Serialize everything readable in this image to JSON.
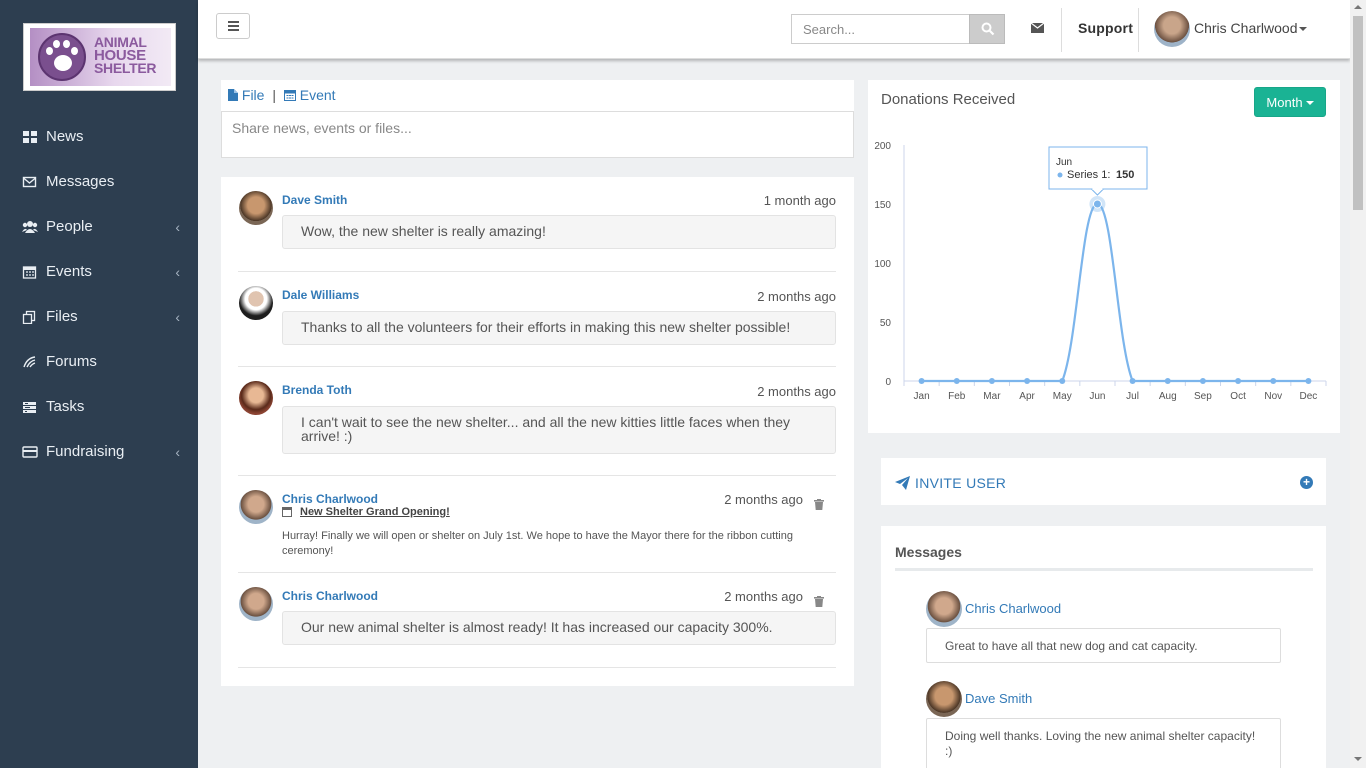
{
  "brand": {
    "logo_line1": "ANIMAL",
    "logo_line2": "HOUSE",
    "logo_line3": "SHELTER",
    "logo_color": "#8b5a9e"
  },
  "sidebar": {
    "items": [
      {
        "label": "News",
        "icon": "grid-icon",
        "has_submenu": false
      },
      {
        "label": "Messages",
        "icon": "envelope-icon",
        "has_submenu": false
      },
      {
        "label": "People",
        "icon": "users-icon",
        "has_submenu": true
      },
      {
        "label": "Events",
        "icon": "calendar-icon",
        "has_submenu": true
      },
      {
        "label": "Files",
        "icon": "files-icon",
        "has_submenu": true
      },
      {
        "label": "Forums",
        "icon": "forums-icon",
        "has_submenu": false
      },
      {
        "label": "Tasks",
        "icon": "tasks-icon",
        "has_submenu": false
      },
      {
        "label": "Fundraising",
        "icon": "credit-card-icon",
        "has_submenu": true
      }
    ]
  },
  "header": {
    "search_placeholder": "Search...",
    "support_label": "Support",
    "user_name": "Chris Charlwood"
  },
  "composer": {
    "file_label": "File",
    "separator": "|",
    "event_label": "Event",
    "placeholder": "Share news, events or files..."
  },
  "feed": {
    "posts": [
      {
        "author": "Dave Smith",
        "time": "1 month ago",
        "text": "Wow, the new shelter is really amazing!"
      },
      {
        "author": "Dale Williams",
        "time": "2 months ago",
        "text": "Thanks to all the volunteers for their efforts in making this new shelter possible!"
      },
      {
        "author": "Brenda Toth",
        "time": "2 months ago",
        "text": "I can't wait to see the new shelter... and all the new kitties little faces when they arrive! :)"
      },
      {
        "author": "Chris Charlwood",
        "time": "2 months ago",
        "event_title": "New Shelter Grand Opening!",
        "text": "Hurray! Finally we will open or shelter on July 1st. We hope to have the Mayor there for the ribbon cutting ceremony!"
      },
      {
        "author": "Chris Charlwood",
        "time": "2 months ago",
        "text": "Our new animal shelter is almost ready! It has increased our capacity 300%."
      }
    ]
  },
  "donations": {
    "title": "Donations Received",
    "period_button": "Month",
    "tooltip_month": "Jun",
    "tooltip_series": "Series 1:",
    "tooltip_value": "150"
  },
  "chart_data": {
    "type": "line",
    "title": "",
    "categories": [
      "Jan",
      "Feb",
      "Mar",
      "Apr",
      "May",
      "Jun",
      "Jul",
      "Aug",
      "Sep",
      "Oct",
      "Nov",
      "Dec"
    ],
    "series": [
      {
        "name": "Series 1",
        "values": [
          0,
          0,
          0,
          0,
          0,
          150,
          0,
          0,
          0,
          0,
          0,
          0
        ],
        "color": "#7cb5ec"
      }
    ],
    "yticks": [
      0,
      50,
      100,
      150,
      200
    ],
    "ylim": [
      0,
      200
    ],
    "smooth": true,
    "legend": "none"
  },
  "invite": {
    "label": "INVITE USER"
  },
  "messages": {
    "title": "Messages",
    "items": [
      {
        "author": "Chris Charlwood",
        "text": "Great to have all that new dog and cat capacity."
      },
      {
        "author": "Dave Smith",
        "text": "Doing well thanks. Loving the new animal shelter capacity! :)"
      }
    ]
  }
}
